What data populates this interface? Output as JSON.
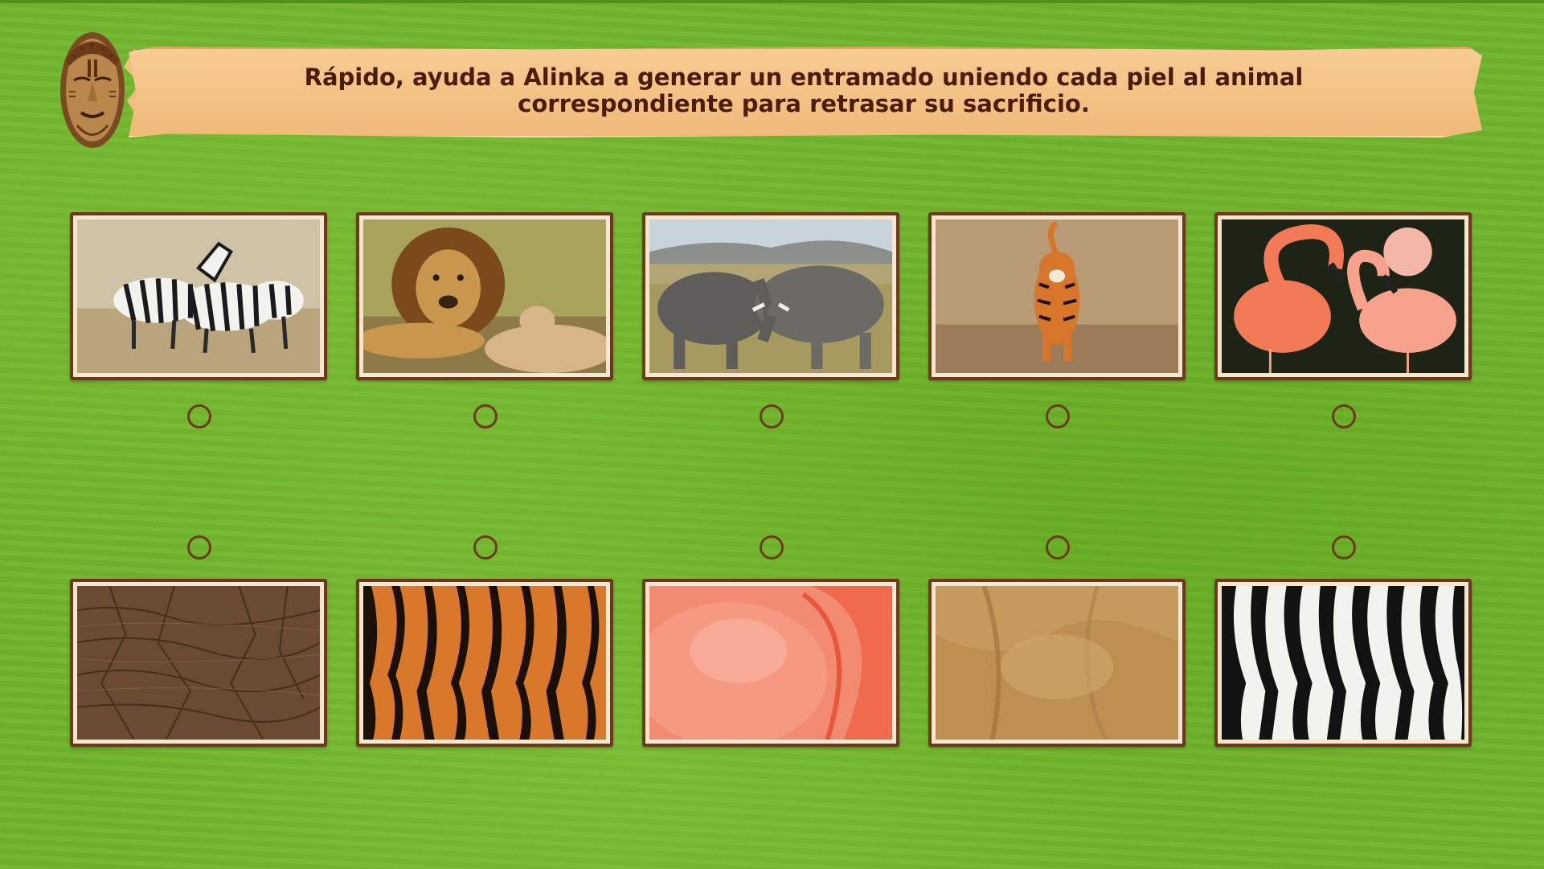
{
  "instructions": {
    "line1": "Rápido, ayuda a Alinka a generar un entramado uniendo cada piel al animal",
    "line2": "correspondiente para retrasar su sacrificio."
  },
  "animals": [
    {
      "name": "zebra",
      "icon": "zebra-photo"
    },
    {
      "name": "lion",
      "icon": "lion-photo"
    },
    {
      "name": "elephant",
      "icon": "elephant-photo"
    },
    {
      "name": "tiger",
      "icon": "tiger-photo"
    },
    {
      "name": "flamingo",
      "icon": "flamingo-photo"
    }
  ],
  "skins": [
    {
      "name": "elephant-skin",
      "icon": "elephant-skin-texture"
    },
    {
      "name": "tiger-skin",
      "icon": "tiger-skin-texture"
    },
    {
      "name": "flamingo-skin",
      "icon": "flamingo-skin-texture"
    },
    {
      "name": "lion-skin",
      "icon": "lion-skin-texture"
    },
    {
      "name": "zebra-skin",
      "icon": "zebra-skin-texture"
    }
  ],
  "colors": {
    "background": "#6fb52c",
    "banner": "#f3c184",
    "text": "#4a1c0a",
    "frame": "#6b3b17"
  }
}
